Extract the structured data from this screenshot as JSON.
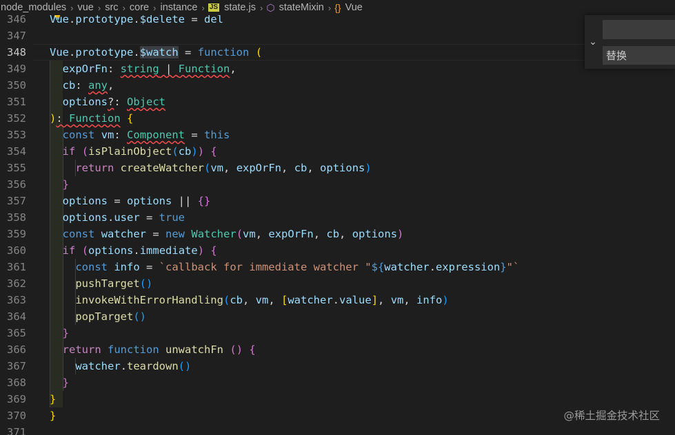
{
  "breadcrumb": [
    "node_modules",
    "vue",
    "src",
    "core",
    "instance",
    "state.js",
    "stateMixin",
    "Vue"
  ],
  "js_badge": "JS",
  "line_numbers": [
    "346",
    "347",
    "348",
    "349",
    "350",
    "351",
    "352",
    "353",
    "354",
    "355",
    "356",
    "357",
    "358",
    "359",
    "360",
    "361",
    "362",
    "363",
    "364",
    "365",
    "366",
    "367",
    "368",
    "369",
    "370",
    "371"
  ],
  "current_line": "348",
  "find_widget": {
    "replace_placeholder": "替换",
    "toggle_icon": "chevron-down"
  },
  "watermark": "@稀土掘金技术社区",
  "colors": {
    "keyword": "#569cd6",
    "control": "#c586c0",
    "variable": "#9cdcfe",
    "function": "#dcdcaa",
    "type": "#4ec9b0",
    "string": "#ce9178",
    "bracket1": "#ffd700",
    "bracket2": "#da70d6",
    "bracket3": "#179fff"
  },
  "code": [
    [
      [
        "Vue",
        "v"
      ],
      [
        ".",
        "p"
      ],
      [
        "prototype",
        "v"
      ],
      [
        ".",
        "p"
      ],
      [
        "$delete",
        "v"
      ],
      [
        " = ",
        "p"
      ],
      [
        "del",
        "v"
      ]
    ],
    [],
    [
      [
        "Vue",
        "v"
      ],
      [
        ".",
        "p"
      ],
      [
        "prototype",
        "v"
      ],
      [
        ".",
        "p"
      ],
      [
        "$watch",
        "v hl"
      ],
      [
        " = ",
        "p"
      ],
      [
        "function",
        "k"
      ],
      [
        " ",
        "p"
      ],
      [
        "(",
        "p1"
      ]
    ],
    [
      [
        "  ",
        "p"
      ],
      [
        "expOrFn",
        "v"
      ],
      [
        ": ",
        "p"
      ],
      [
        "string",
        "t sq"
      ],
      [
        " | ",
        "p sq"
      ],
      [
        "Function",
        "t sq"
      ],
      [
        ",",
        "p"
      ]
    ],
    [
      [
        "  ",
        "p"
      ],
      [
        "cb",
        "v"
      ],
      [
        ": ",
        "p"
      ],
      [
        "any",
        "t sq"
      ],
      [
        ",",
        "p"
      ]
    ],
    [
      [
        "  ",
        "p"
      ],
      [
        "options",
        "v"
      ],
      [
        "?",
        "p sq"
      ],
      [
        ": ",
        "p"
      ],
      [
        "Object",
        "t sq"
      ]
    ],
    [
      [
        ")",
        "p1"
      ],
      [
        ": ",
        "p sq"
      ],
      [
        "Function",
        "t sq"
      ],
      [
        " ",
        "p"
      ],
      [
        "{",
        "p1"
      ]
    ],
    [
      [
        "  ",
        "p"
      ],
      [
        "const",
        "k"
      ],
      [
        " ",
        "p"
      ],
      [
        "vm",
        "v"
      ],
      [
        ": ",
        "p"
      ],
      [
        "Component",
        "t sq"
      ],
      [
        " = ",
        "p"
      ],
      [
        "this",
        "k"
      ]
    ],
    [
      [
        "  ",
        "p"
      ],
      [
        "if",
        "c"
      ],
      [
        " ",
        "p"
      ],
      [
        "(",
        "p2"
      ],
      [
        "isPlainObject",
        "f"
      ],
      [
        "(",
        "p3"
      ],
      [
        "cb",
        "v"
      ],
      [
        ")",
        "p3"
      ],
      [
        ")",
        "p2"
      ],
      [
        " ",
        "p"
      ],
      [
        "{",
        "p2"
      ]
    ],
    [
      [
        "    ",
        "p"
      ],
      [
        "return",
        "c"
      ],
      [
        " ",
        "p"
      ],
      [
        "createWatcher",
        "f"
      ],
      [
        "(",
        "p3"
      ],
      [
        "vm",
        "v"
      ],
      [
        ", ",
        "p"
      ],
      [
        "expOrFn",
        "v"
      ],
      [
        ", ",
        "p"
      ],
      [
        "cb",
        "v"
      ],
      [
        ", ",
        "p"
      ],
      [
        "options",
        "v"
      ],
      [
        ")",
        "p3"
      ]
    ],
    [
      [
        "  ",
        "p"
      ],
      [
        "}",
        "p2"
      ]
    ],
    [
      [
        "  ",
        "p"
      ],
      [
        "options",
        "v"
      ],
      [
        " = ",
        "p"
      ],
      [
        "options",
        "v"
      ],
      [
        " || ",
        "p"
      ],
      [
        "{}",
        "p2"
      ]
    ],
    [
      [
        "  ",
        "p"
      ],
      [
        "options",
        "v"
      ],
      [
        ".",
        "p"
      ],
      [
        "user",
        "v"
      ],
      [
        " = ",
        "p"
      ],
      [
        "true",
        "k"
      ]
    ],
    [
      [
        "  ",
        "p"
      ],
      [
        "const",
        "k"
      ],
      [
        " ",
        "p"
      ],
      [
        "watcher",
        "v"
      ],
      [
        " = ",
        "p"
      ],
      [
        "new",
        "k"
      ],
      [
        " ",
        "p"
      ],
      [
        "Watcher",
        "t"
      ],
      [
        "(",
        "p2"
      ],
      [
        "vm",
        "v"
      ],
      [
        ", ",
        "p"
      ],
      [
        "expOrFn",
        "v"
      ],
      [
        ", ",
        "p"
      ],
      [
        "cb",
        "v"
      ],
      [
        ", ",
        "p"
      ],
      [
        "options",
        "v"
      ],
      [
        ")",
        "p2"
      ]
    ],
    [
      [
        "  ",
        "p"
      ],
      [
        "if",
        "c"
      ],
      [
        " ",
        "p"
      ],
      [
        "(",
        "p2"
      ],
      [
        "options",
        "v"
      ],
      [
        ".",
        "p"
      ],
      [
        "immediate",
        "v"
      ],
      [
        ")",
        "p2"
      ],
      [
        " ",
        "p"
      ],
      [
        "{",
        "p2"
      ]
    ],
    [
      [
        "    ",
        "p"
      ],
      [
        "const",
        "k"
      ],
      [
        " ",
        "p"
      ],
      [
        "info",
        "v"
      ],
      [
        " = ",
        "p"
      ],
      [
        "`callback for immediate watcher \"",
        "s"
      ],
      [
        "${",
        "k"
      ],
      [
        "watcher",
        "v"
      ],
      [
        ".",
        "p"
      ],
      [
        "expression",
        "v"
      ],
      [
        "}",
        "k"
      ],
      [
        "\"`",
        "s"
      ]
    ],
    [
      [
        "    ",
        "p"
      ],
      [
        "pushTarget",
        "f"
      ],
      [
        "()",
        "p3"
      ]
    ],
    [
      [
        "    ",
        "p"
      ],
      [
        "invokeWithErrorHandling",
        "f"
      ],
      [
        "(",
        "p3"
      ],
      [
        "cb",
        "v"
      ],
      [
        ", ",
        "p"
      ],
      [
        "vm",
        "v"
      ],
      [
        ", ",
        "p"
      ],
      [
        "[",
        "p1"
      ],
      [
        "watcher",
        "v"
      ],
      [
        ".",
        "p"
      ],
      [
        "value",
        "v"
      ],
      [
        "]",
        "p1"
      ],
      [
        ", ",
        "p"
      ],
      [
        "vm",
        "v"
      ],
      [
        ", ",
        "p"
      ],
      [
        "info",
        "v"
      ],
      [
        ")",
        "p3"
      ]
    ],
    [
      [
        "    ",
        "p"
      ],
      [
        "popTarget",
        "f"
      ],
      [
        "()",
        "p3"
      ]
    ],
    [
      [
        "  ",
        "p"
      ],
      [
        "}",
        "p2"
      ]
    ],
    [
      [
        "  ",
        "p"
      ],
      [
        "return",
        "c"
      ],
      [
        " ",
        "p"
      ],
      [
        "function",
        "k"
      ],
      [
        " ",
        "p"
      ],
      [
        "unwatchFn",
        "f"
      ],
      [
        " ",
        "p"
      ],
      [
        "()",
        "p2"
      ],
      [
        " ",
        "p"
      ],
      [
        "{",
        "p2"
      ]
    ],
    [
      [
        "    ",
        "p"
      ],
      [
        "watcher",
        "v"
      ],
      [
        ".",
        "p"
      ],
      [
        "teardown",
        "f"
      ],
      [
        "()",
        "p3"
      ]
    ],
    [
      [
        "  ",
        "p"
      ],
      [
        "}",
        "p2"
      ]
    ],
    [
      [
        "}",
        "p1"
      ]
    ],
    [
      [
        "}",
        "p1"
      ]
    ],
    []
  ]
}
